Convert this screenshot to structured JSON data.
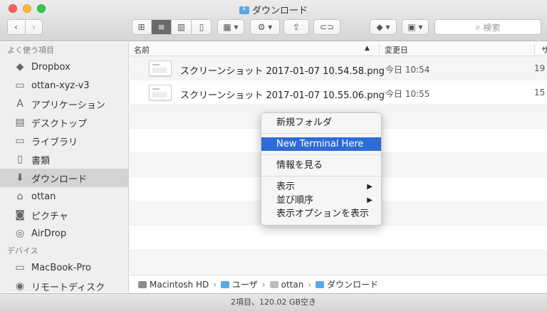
{
  "window": {
    "title": "ダウンロード"
  },
  "toolbar": {
    "back_icon": "chevron-left-icon",
    "forward_icon": "chevron-right-icon",
    "view_icons": [
      "icon-view-icon",
      "list-view-icon",
      "column-view-icon",
      "coverflow-view-icon"
    ],
    "search_placeholder": "検索"
  },
  "sidebar": {
    "favorites_header": "よく使う項目",
    "items": [
      {
        "label": "Dropbox",
        "icon": "dropbox-icon"
      },
      {
        "label": "ottan-xyz-v3",
        "icon": "folder-icon"
      },
      {
        "label": "アプリケーション",
        "icon": "applications-icon"
      },
      {
        "label": "デスクトップ",
        "icon": "desktop-icon"
      },
      {
        "label": "ライブラリ",
        "icon": "folder-icon"
      },
      {
        "label": "書類",
        "icon": "documents-icon"
      },
      {
        "label": "ダウンロード",
        "icon": "downloads-icon"
      },
      {
        "label": "ottan",
        "icon": "home-icon"
      },
      {
        "label": "ピクチャ",
        "icon": "camera-icon"
      },
      {
        "label": "AirDrop",
        "icon": "airdrop-icon"
      }
    ],
    "devices_header": "デバイス",
    "devices": [
      {
        "label": "MacBook-Pro",
        "icon": "laptop-icon"
      },
      {
        "label": "リモートディスク",
        "icon": "disc-icon"
      }
    ]
  },
  "filelist": {
    "columns": {
      "name": "名前",
      "modified": "変更日",
      "size": "サ"
    },
    "rows": [
      {
        "name": "スクリーンショット 2017-01-07 10.54.58.png",
        "modified": "今日 10:54",
        "size": "19"
      },
      {
        "name": "スクリーンショット 2017-01-07 10.55.06.png",
        "modified": "今日 10:55",
        "size": "15"
      }
    ]
  },
  "context_menu": {
    "items": [
      "新規フォルダ",
      "New Terminal Here",
      "情報を見る",
      "表示",
      "並び順序",
      "表示オプションを表示"
    ]
  },
  "pathbar": {
    "segments": [
      "Macintosh HD",
      "ユーザ",
      "ottan",
      "ダウンロード"
    ]
  },
  "statusbar": {
    "text": "2項目、120.02 GB空き"
  },
  "colors": {
    "highlight": "#2d6bd6",
    "sidebar_bg": "#efeff0",
    "traffic_red": "#fc605c",
    "traffic_yellow": "#fdbc40",
    "traffic_green": "#34c84a"
  }
}
